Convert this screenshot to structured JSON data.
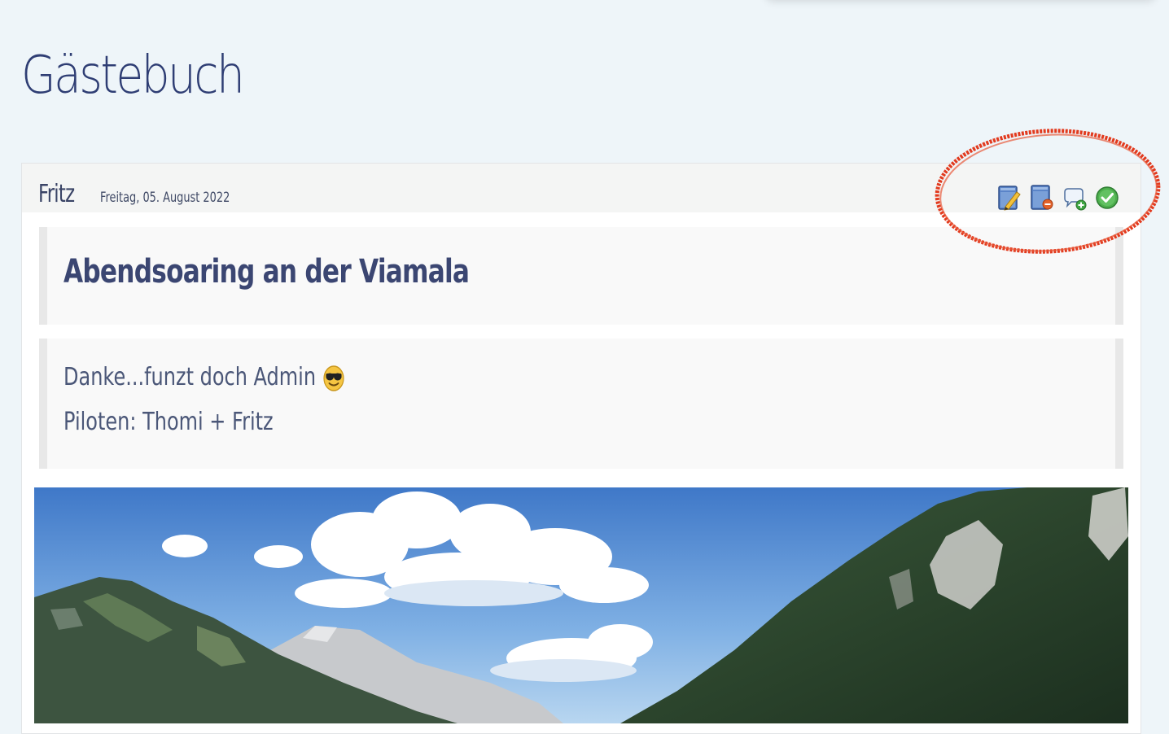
{
  "page": {
    "title": "Gästebuch"
  },
  "entry": {
    "author": "Fritz",
    "date": "Freitag, 05. August 2022",
    "subject": "Abendsoaring an der Viamala",
    "body_line1": "Danke...funzt doch Admin",
    "body_line2": "Piloten: Thomi + Fritz",
    "emoji_icon": "sunglasses-smiley-icon",
    "actions": [
      {
        "icon": "edit-entry-icon"
      },
      {
        "icon": "delete-entry-icon"
      },
      {
        "icon": "add-comment-icon"
      },
      {
        "icon": "approve-checkmark-icon"
      }
    ]
  },
  "colors": {
    "background": "#eef5f9",
    "title": "#2f3e74",
    "callout": "#e23a1e"
  }
}
